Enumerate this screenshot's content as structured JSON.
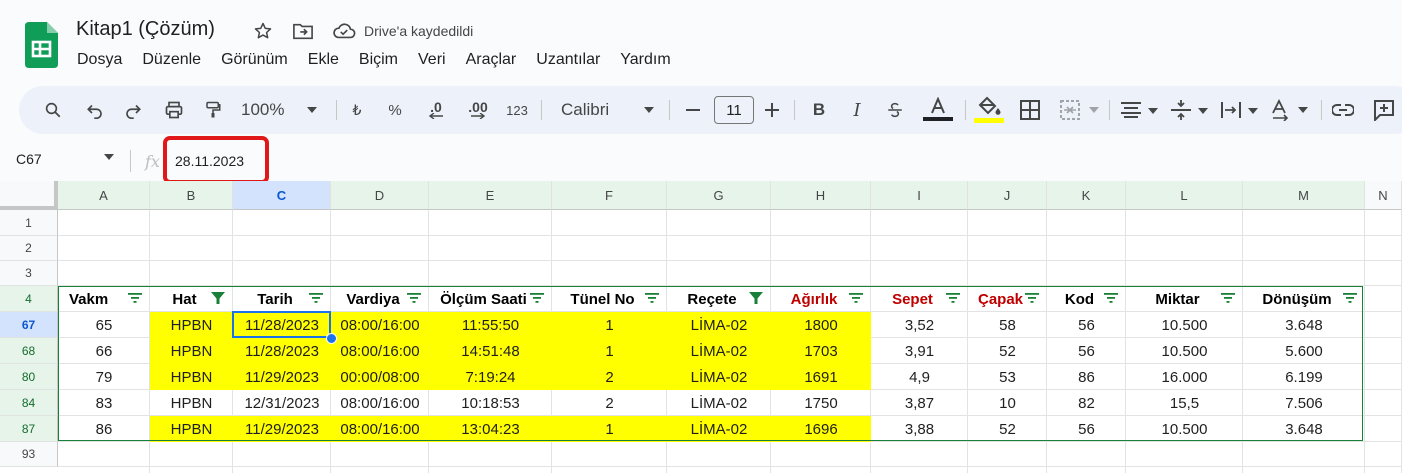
{
  "header": {
    "title": "Kitap1 (Çözüm)",
    "save_status": "Drive'a kaydedildi",
    "icons": [
      "sheets-logo-icon",
      "star-icon",
      "move-folder-icon",
      "cloud-saved-icon"
    ]
  },
  "menu": [
    "Dosya",
    "Düzenle",
    "Görünüm",
    "Ekle",
    "Biçim",
    "Veri",
    "Araçlar",
    "Uzantılar",
    "Yardım"
  ],
  "toolbar": {
    "zoom": "100%",
    "currency": "₺",
    "percent": "%",
    "decrease_decimal": ".0",
    "increase_decimal": ".00",
    "number_format": "123",
    "font": "Calibri",
    "font_size": "11",
    "accent_text_color": "#202124",
    "fill_color": "#ffff00"
  },
  "formula_bar": {
    "name_box": "C67",
    "fx": "fx",
    "value": "28.11.2023",
    "highlight_color": "#e0181a"
  },
  "columns": [
    "A",
    "B",
    "C",
    "D",
    "E",
    "F",
    "G",
    "H",
    "I",
    "J",
    "K",
    "L",
    "M",
    "N"
  ],
  "row_numbers": [
    "1",
    "2",
    "3",
    "4",
    "67",
    "68",
    "80",
    "84",
    "87",
    "93"
  ],
  "table": {
    "headers": [
      "Vakm",
      "Hat",
      "Tarih",
      "Vardiya",
      "Ölçüm Saati",
      "Tünel No",
      "Reçete",
      "Ağırlık",
      "Sepet",
      "Çapak",
      "Kod",
      "Miktar",
      "Dönüşüm"
    ],
    "red_headers": [
      "Ağırlık",
      "Sepet",
      "Çapak"
    ],
    "active_filters": [
      "Hat",
      "Reçete"
    ],
    "rows": [
      [
        "65",
        "HPBN",
        "11/28/2023",
        "08:00/16:00",
        "11:55:50",
        "1",
        "LİMA-02",
        "1800",
        "3,52",
        "58",
        "56",
        "10.500",
        "3.648"
      ],
      [
        "66",
        "HPBN",
        "11/28/2023",
        "08:00/16:00",
        "14:51:48",
        "1",
        "LİMA-02",
        "1703",
        "3,91",
        "52",
        "56",
        "10.500",
        "5.600"
      ],
      [
        "79",
        "HPBN",
        "11/29/2023",
        "00:00/08:00",
        "7:19:24",
        "2",
        "LİMA-02",
        "1691",
        "4,9",
        "53",
        "86",
        "16.000",
        "6.199"
      ],
      [
        "83",
        "HPBN",
        "12/31/2023",
        "08:00/16:00",
        "10:18:53",
        "2",
        "LİMA-02",
        "1750",
        "3,87",
        "10",
        "82",
        "15,5",
        "7.506"
      ],
      [
        "86",
        "HPBN",
        "11/29/2023",
        "08:00/16:00",
        "13:04:23",
        "1",
        "LİMA-02",
        "1696",
        "3,88",
        "52",
        "56",
        "10.500",
        "3.648"
      ]
    ],
    "highlighted_rows": [
      true,
      true,
      true,
      false,
      true
    ],
    "highlight_color": "#ffff00",
    "selected_cell": "C67"
  }
}
